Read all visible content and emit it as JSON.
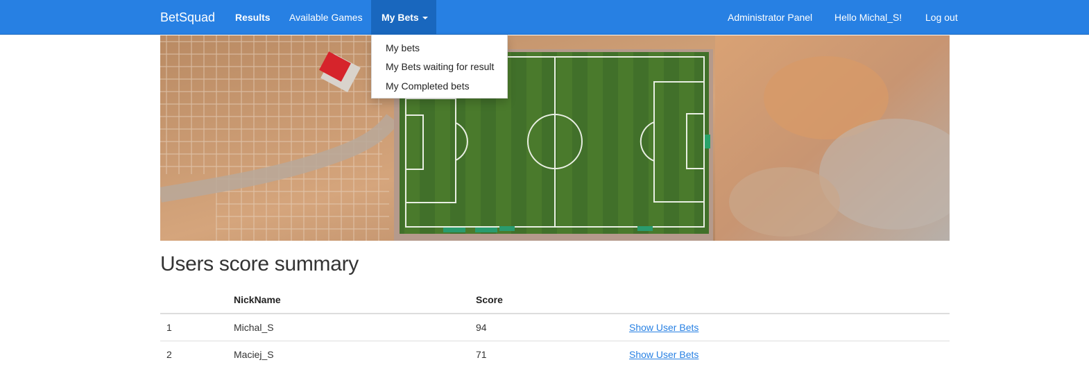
{
  "navbar": {
    "brand": "BetSquad",
    "results_label": "Results",
    "available_games_label": "Available Games",
    "my_bets_label": "My Bets",
    "admin_panel_label": "Administrator Panel",
    "greeting": "Hello Michal_S!",
    "logout_label": "Log out",
    "bar_color": "#2780e3",
    "active_color": "#1967be"
  },
  "dropdown": {
    "items": [
      "My bets",
      "My Bets waiting for result",
      "My Completed bets"
    ]
  },
  "hero": {
    "description_icon": "soccer-field-aerial-image"
  },
  "page": {
    "title": "Users score summary"
  },
  "table": {
    "columns": [
      "",
      "NickName",
      "Score",
      ""
    ],
    "rows": [
      {
        "rank": "1",
        "nick": "Michal_S",
        "score": "94",
        "link": "Show User Bets"
      },
      {
        "rank": "2",
        "nick": "Maciej_S",
        "score": "71",
        "link": "Show User Bets"
      }
    ]
  }
}
